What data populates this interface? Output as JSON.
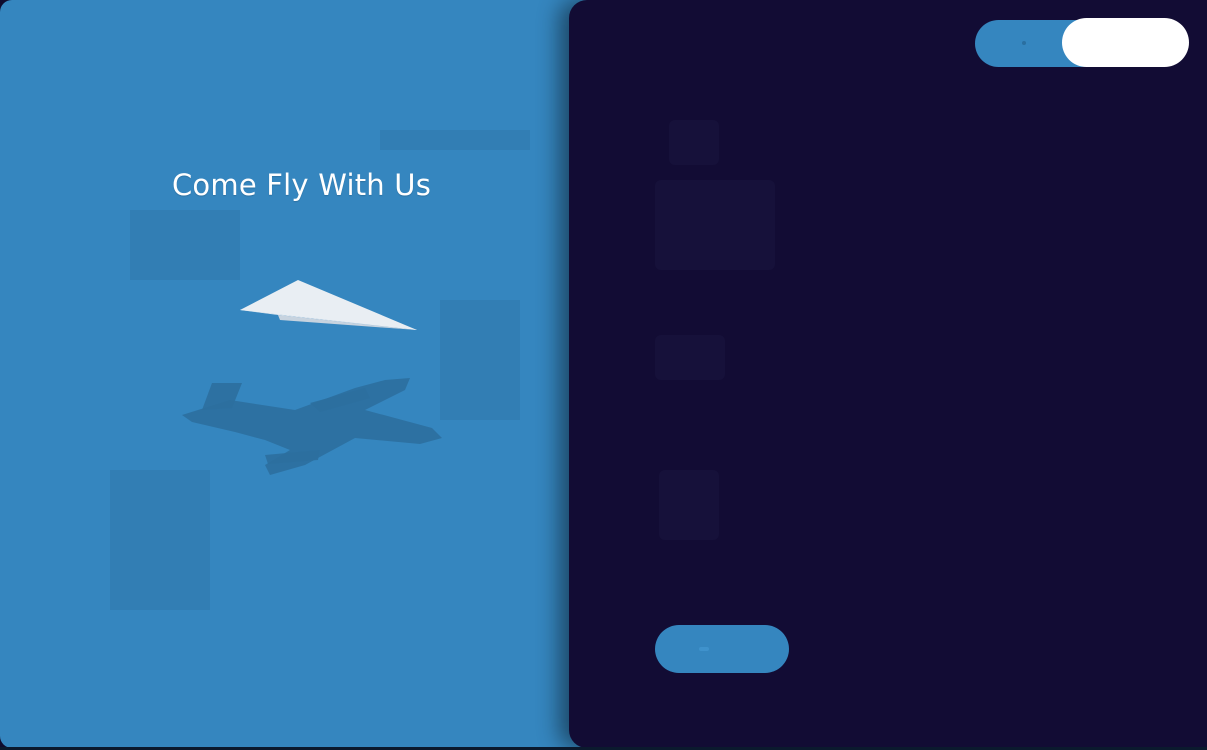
{
  "hero": {
    "title": "Come Fly With Us"
  },
  "colors": {
    "left_panel": "#3586bf",
    "right_panel": "#120c34",
    "toggle": "#3586bf",
    "toggle_knob": "#ffffff",
    "submit_button": "#3586bf"
  },
  "icons": {
    "paper_plane": "paper-plane-icon",
    "airplane_shadow": "airplane-shadow-icon"
  }
}
